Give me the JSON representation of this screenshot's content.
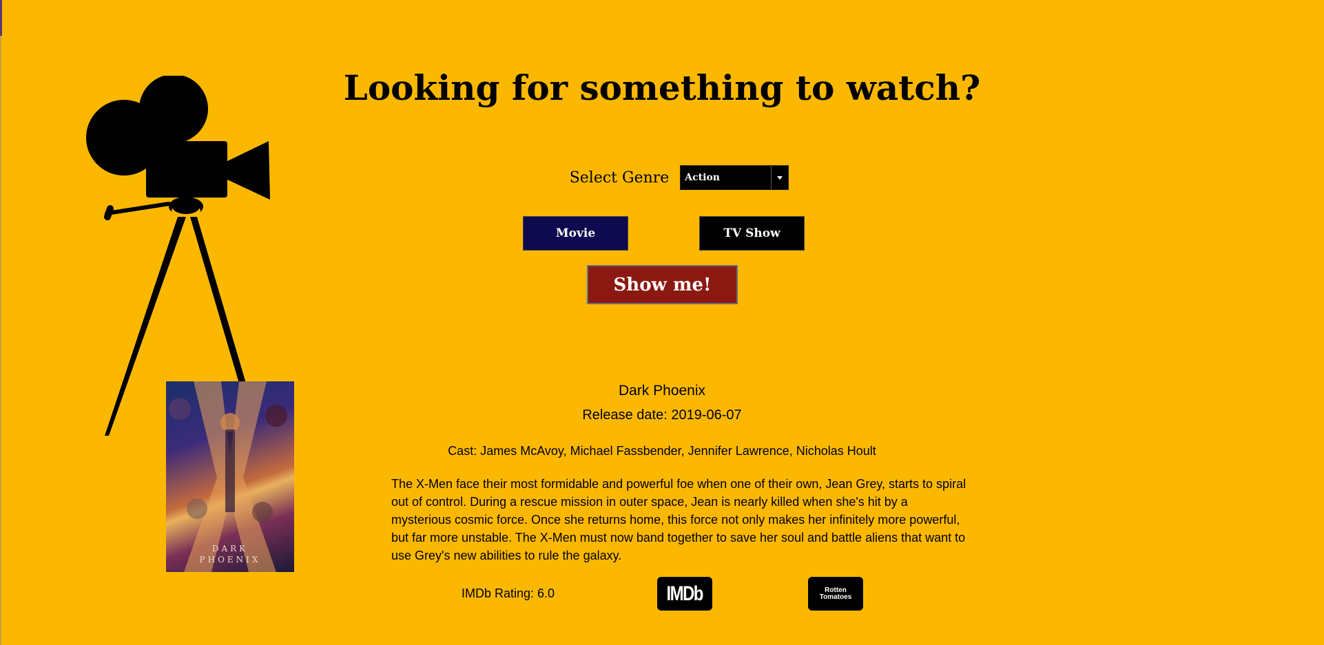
{
  "header": {
    "title": "Looking for something to watch?"
  },
  "form": {
    "genre_label": "Select Genre",
    "genre_selected": "Action",
    "movie_button": "Movie",
    "tv_button": "TV Show",
    "submit_button": "Show me!"
  },
  "result": {
    "title": "Dark Phoenix",
    "release": "Release date: 2019-06-07",
    "cast": "Cast: James McAvoy, Michael Fassbender, Jennifer Lawrence, Nicholas Hoult",
    "overview": "The X-Men face their most formidable and powerful foe when one of their own, Jean Grey, starts to spiral out of control. During a rescue mission in outer space, Jean is nearly killed when she's hit by a mysterious cosmic force. Once she returns home, this force not only makes her infinitely more powerful, but far more unstable. The X-Men must now band together to save her soul and battle aliens that want to use Grey's new abilities to rule the galaxy.",
    "rating": "IMDb Rating: 6.0",
    "poster_line1": "DARK",
    "poster_line2": "PHOENIX"
  },
  "links": {
    "imdb_label": "IMDb",
    "rt_line1": "Rotten",
    "rt_line2": "Tomatoes"
  },
  "colors": {
    "background": "#FCB800",
    "movie_button": "#0F0A50",
    "tv_button": "#000000",
    "submit_button": "#8B1912"
  }
}
